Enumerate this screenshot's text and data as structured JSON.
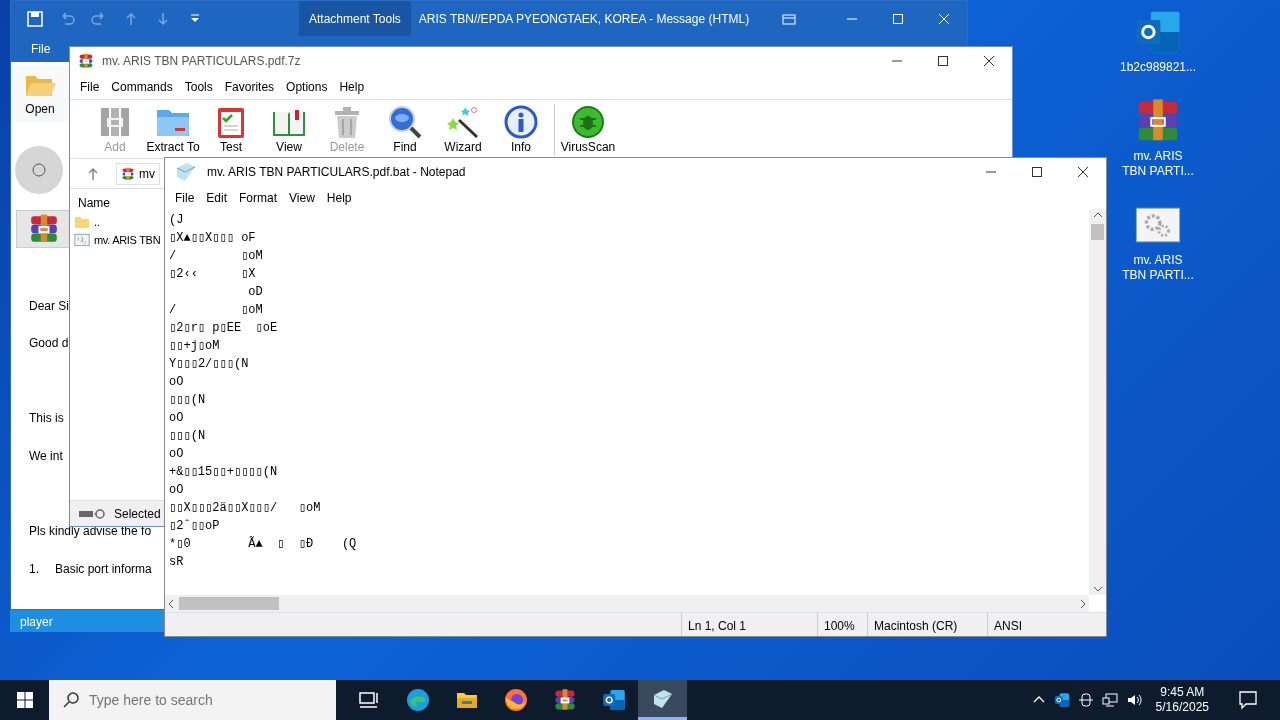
{
  "outlook": {
    "title": "ARIS TBN//EPDA PYEONGTAEK, KOREA  -  Message (HTML)",
    "context_tab": "Attachment Tools",
    "file_tab": "File",
    "open_button": "Open",
    "body_lines": [
      "Dear Si",
      "Good d",
      "This is",
      "We int",
      "Pls kindly advise the fo"
    ],
    "list_item": {
      "number": "1.",
      "text": "Basic port informa"
    },
    "footer": "player"
  },
  "winrar": {
    "title": "mv. ARIS TBN PARTICULARS.pdf.7z",
    "menu": [
      "File",
      "Commands",
      "Tools",
      "Favorites",
      "Options",
      "Help"
    ],
    "toolbar": [
      {
        "label": "Add",
        "kind": "add",
        "disabled": true
      },
      {
        "label": "Extract To",
        "kind": "extract",
        "disabled": false
      },
      {
        "label": "Test",
        "kind": "test",
        "disabled": false
      },
      {
        "label": "View",
        "kind": "view",
        "disabled": false
      },
      {
        "label": "Delete",
        "kind": "delete",
        "disabled": true
      },
      {
        "label": "Find",
        "kind": "find",
        "disabled": false
      },
      {
        "label": "Wizard",
        "kind": "wizard",
        "disabled": false
      },
      {
        "label": "Info",
        "kind": "info",
        "disabled": false
      },
      {
        "label": "VirusScan",
        "kind": "scan",
        "disabled": false
      }
    ],
    "path": "mv",
    "column": "Name",
    "files": [
      {
        "name": "..",
        "kind": "folder"
      },
      {
        "name": "mv. ARIS TBN",
        "kind": "script"
      }
    ],
    "status": "Selected"
  },
  "notepad": {
    "title": "mv. ARIS TBN PARTICULARS.pdf.bat - Notepad",
    "menu": [
      "File",
      "Edit",
      "Format",
      "View",
      "Help"
    ],
    "text": "(J\n▯X▲▯▯X▯▯▯ oF\n/         ▯oM\n▯2‹‹      ▯X\n           oD\n/         ▯oM\n▯2▯r▯ p▯EE  ▯oE\n▯▯+j▯oM\nY▯▯▯2/▯▯▯(N\noO\n▯▯▯(N\noO\n▯▯▯(N\noO\n+&▯▯15▯▯+▯▯▯▯(N\noO\n▯▯X▯▯▯2ä▯▯X▯▯▯/   ▯oM\n▯2ˆ▯▯oP\n*▯0        Ã▲  ▯  ▯Ð    (Q\nsR",
    "status": [
      "Ln 1, Col 1",
      "100%",
      "Macintosh (CR)",
      "ANSI"
    ]
  },
  "desktop_icons": [
    {
      "label": "1b2c989821...",
      "kind": "outlook"
    },
    {
      "label": "mv. ARIS TBN PARTI...",
      "kind": "archive"
    },
    {
      "label": "mv. ARIS TBN PARTI...",
      "kind": "script"
    }
  ],
  "taskbar": {
    "search_placeholder": "Type here to search",
    "apps": [
      {
        "kind": "taskview",
        "active": false
      },
      {
        "kind": "edge",
        "active": false
      },
      {
        "kind": "explorer",
        "active": false
      },
      {
        "kind": "firefox",
        "active": false
      },
      {
        "kind": "archive",
        "active": false
      },
      {
        "kind": "outlook",
        "active": false
      },
      {
        "kind": "notepad",
        "active": true
      }
    ],
    "time": "9:45 AM",
    "date": "5/16/2025"
  }
}
